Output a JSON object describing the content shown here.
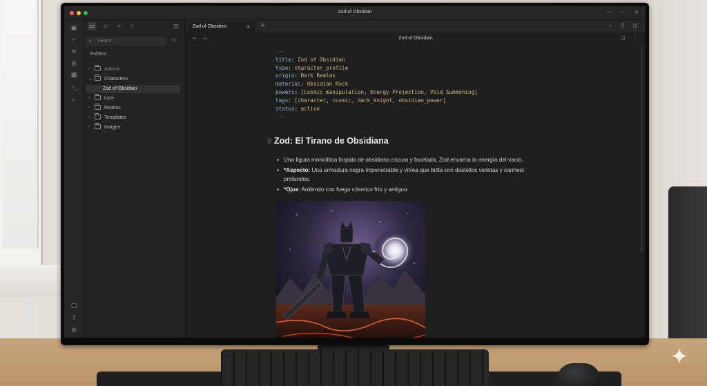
{
  "window": {
    "title": "Zod of Obsidian"
  },
  "sidebar": {
    "search_placeholder": "Search",
    "folders_heading": "Folders",
    "tree": [
      {
        "label": "Arteme",
        "kind": "folder",
        "expanded": false
      },
      {
        "label": "Characters",
        "kind": "folder",
        "expanded": true
      },
      {
        "label": "Zod of Obsidian",
        "kind": "file",
        "selected": true
      },
      {
        "label": "Lore",
        "kind": "folder",
        "expanded": false
      },
      {
        "label": "Realms",
        "kind": "folder",
        "expanded": false
      },
      {
        "label": "Templates",
        "kind": "folder",
        "expanded": false
      },
      {
        "label": "Images",
        "kind": "folder",
        "expanded": false
      }
    ]
  },
  "tabs": [
    {
      "label": "Zod of Obsidien",
      "active": true
    }
  ],
  "editor": {
    "doc_title": "Zod of Obsidian",
    "frontmatter": {
      "delim": "---",
      "fields": [
        {
          "key": "title",
          "value": "Zod of Obsidian"
        },
        {
          "key": "type",
          "value": "character_profile"
        },
        {
          "key": "origin",
          "value": "Dark Realms"
        },
        {
          "key": "material",
          "value": "Obsidian Rock"
        },
        {
          "key": "powers",
          "value": "[Cosmic manipulation, Energy Projection, Void Summoning]"
        },
        {
          "key": "tags",
          "value": "[character, cosmic, dark_knight, obsidian_power]"
        },
        {
          "key": "status",
          "value": "active"
        }
      ]
    },
    "heading_hash": "#",
    "heading": "Zod: El Tirano de Obsidiana",
    "bullets": [
      {
        "bold": "",
        "text": "Una figura monolítica forjada de obsidiana oscura y facetada, Zod encarna la energía del vacío."
      },
      {
        "bold": "*Aspecto:",
        "text": " Una armadura negra impenetrable y vítrea que brilla con destellos violetas y carmesí profundos."
      },
      {
        "bold": "*Ojos",
        "text": ": Ardiendo con fuego cósmico frío y antiguo."
      }
    ]
  },
  "colors": {
    "screen_bg": "#1e1e1e",
    "sidebar_bg": "#232323",
    "traffic_red": "#ff5f57",
    "traffic_yellow": "#febc2e",
    "traffic_green": "#28c840",
    "yaml_key": "#8fb7d8",
    "yaml_value": "#d4b97d"
  },
  "icons": {
    "ribbon": [
      "files-icon",
      "git-branch-icon",
      "database-icon",
      "grid-icon",
      "calendar-icon",
      "terminal-icon",
      "tag-icon",
      "vault-icon",
      "help-icon",
      "settings-icon"
    ],
    "sidebar_tools": [
      "folder-open-icon",
      "new-folder-icon",
      "search-icon",
      "bookmark-star-icon",
      "sidebar-toggle-icon"
    ]
  }
}
